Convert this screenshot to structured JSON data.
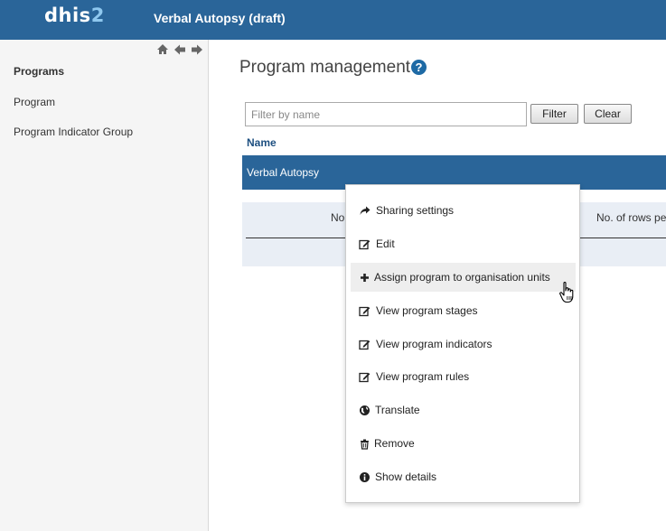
{
  "header": {
    "logo_main": "dhis",
    "logo_accent": "2",
    "app_title": "Verbal Autopsy (draft)"
  },
  "sidebar": {
    "nav_icons": [
      "home-icon",
      "arrow-left-icon",
      "arrow-right-icon"
    ],
    "heading": "Programs",
    "items": [
      {
        "label": "Program"
      },
      {
        "label": "Program Indicator Group"
      }
    ]
  },
  "main": {
    "title": "Program management",
    "help_icon": "question-circle-icon",
    "filter": {
      "placeholder": "Filter by name",
      "value": "",
      "filter_label": "Filter",
      "clear_label": "Clear"
    },
    "table": {
      "column_header": "Name",
      "rows": [
        {
          "name": "Verbal Autopsy",
          "selected": true
        }
      ]
    },
    "pager": {
      "left_text": "No",
      "right_text": "No. of rows pe"
    }
  },
  "context_menu": {
    "items": [
      {
        "label": "Sharing settings",
        "icon": "share-icon"
      },
      {
        "label": "Edit",
        "icon": "edit-icon"
      },
      {
        "label": "Assign program to organisation units",
        "icon": "plus-icon",
        "hover": true
      },
      {
        "label": "View program stages",
        "icon": "edit-icon"
      },
      {
        "label": "View program indicators",
        "icon": "edit-icon"
      },
      {
        "label": "View program rules",
        "icon": "edit-icon"
      },
      {
        "label": "Translate",
        "icon": "globe-icon"
      },
      {
        "label": "Remove",
        "icon": "trash-icon"
      },
      {
        "label": "Show details",
        "icon": "info-icon"
      }
    ]
  },
  "colors": {
    "header_bg": "#2a6599",
    "selected_row_bg": "#2a6599",
    "sidebar_bg": "#f5f5f5",
    "pager_bg": "#e9eef5"
  }
}
